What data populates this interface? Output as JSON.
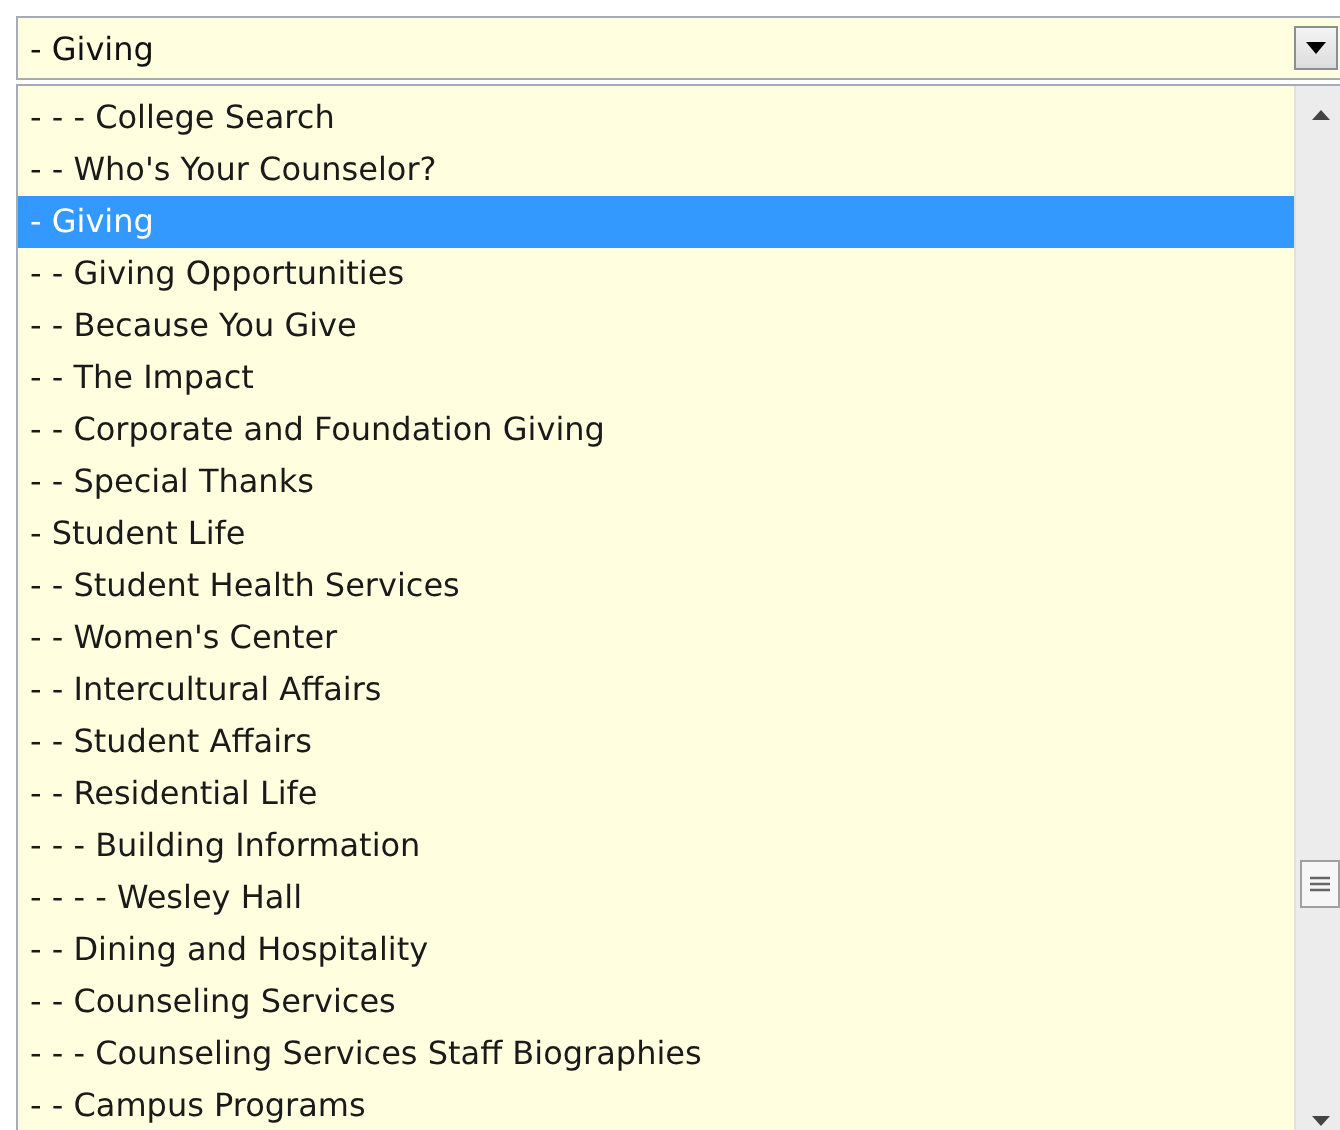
{
  "select": {
    "value": "- Giving"
  },
  "options": [
    {
      "label": "- - - College Search",
      "selected": false
    },
    {
      "label": "- - Who's Your Counselor?",
      "selected": false
    },
    {
      "label": "- Giving",
      "selected": true
    },
    {
      "label": "- - Giving Opportunities",
      "selected": false
    },
    {
      "label": "- - Because You Give",
      "selected": false
    },
    {
      "label": "- - The Impact",
      "selected": false
    },
    {
      "label": "- - Corporate and Foundation Giving",
      "selected": false
    },
    {
      "label": "- - Special Thanks",
      "selected": false
    },
    {
      "label": "- Student Life",
      "selected": false
    },
    {
      "label": "- - Student Health Services",
      "selected": false
    },
    {
      "label": "- - Women's Center",
      "selected": false
    },
    {
      "label": "- - Intercultural Affairs",
      "selected": false
    },
    {
      "label": "- - Student Affairs",
      "selected": false
    },
    {
      "label": "- - Residential Life",
      "selected": false
    },
    {
      "label": "- - - Building Information",
      "selected": false
    },
    {
      "label": "- - - - Wesley Hall",
      "selected": false
    },
    {
      "label": "- - Dining and Hospitality",
      "selected": false
    },
    {
      "label": "- - Counseling Services",
      "selected": false
    },
    {
      "label": "- - - Counseling Services Staff Biographies",
      "selected": false
    },
    {
      "label": "- - Campus Programs",
      "selected": false
    }
  ]
}
